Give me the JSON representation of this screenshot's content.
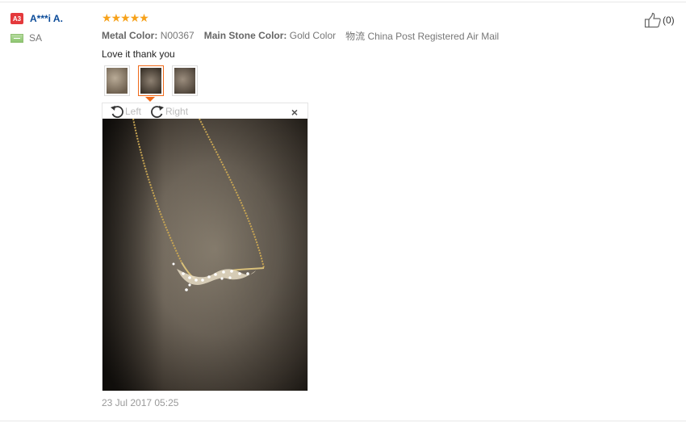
{
  "user": {
    "level_badge": "A3",
    "name": "A***i A.",
    "country": "SA"
  },
  "review": {
    "rating": 5,
    "stars": [
      "★",
      "★",
      "★",
      "★",
      "★"
    ],
    "attributes": [
      {
        "label": "Metal Color:",
        "value": "N00367"
      },
      {
        "label": "Main Stone Color:",
        "value": "Gold Color"
      },
      {
        "label": "物流",
        "value": "China Post Registered Air Mail"
      }
    ],
    "text": "Love it thank you",
    "date": "23 Jul 2017 05:25"
  },
  "viewer": {
    "rotate_left": "Left",
    "rotate_right": "Right",
    "close": "×"
  },
  "helpful": {
    "count": "(0)"
  },
  "colors": {
    "accent_orange": "#f06a1a",
    "star": "#f7a21b",
    "username": "#0b4b99",
    "badge": "#e4393c"
  }
}
